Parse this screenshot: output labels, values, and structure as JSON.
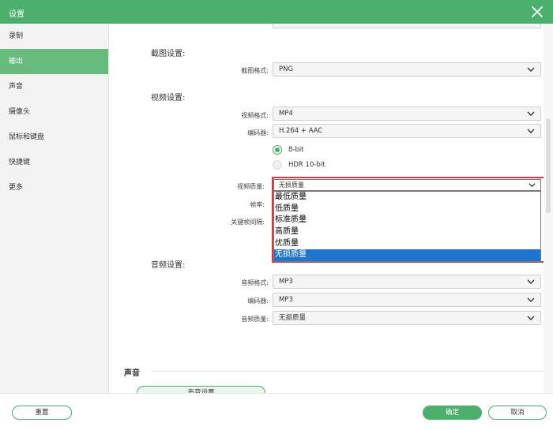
{
  "window": {
    "title": "设置"
  },
  "sidebar": {
    "items": [
      {
        "label": "录制",
        "active": false
      },
      {
        "label": "输出",
        "active": true
      },
      {
        "label": "声音",
        "active": false
      },
      {
        "label": "摄像头",
        "active": false
      },
      {
        "label": "鼠标和键盘",
        "active": false
      },
      {
        "label": "快捷键",
        "active": false
      },
      {
        "label": "更多",
        "active": false
      }
    ]
  },
  "screenshot_settings": {
    "heading": "截图设置:",
    "format_label": "截图格式:",
    "format_value": "PNG"
  },
  "video_settings": {
    "heading": "视频设置:",
    "format_label": "视频格式:",
    "format_value": "MP4",
    "encoder_label": "编码器:",
    "encoder_value": "H.264 + AAC",
    "bit_options": [
      {
        "label": "8-bit",
        "selected": true
      },
      {
        "label": "HDR 10-bit",
        "selected": false
      }
    ],
    "quality_label": "视频质量:",
    "quality_value": "无损质量",
    "quality_options": [
      "最低质量",
      "低质量",
      "标准质量",
      "高质量",
      "优质量",
      "无损质量"
    ],
    "quality_selected_index": 5,
    "framerate_label": "帧率:",
    "keyframe_label": "关键帧间隔:"
  },
  "audio_settings": {
    "heading": "音频设置:",
    "format_label": "音频格式:",
    "format_value": "MP3",
    "encoder_label": "编码器:",
    "encoder_value": "MP3",
    "quality_label": "音频质量:",
    "quality_value": "无损质量"
  },
  "sound_section": {
    "heading": "声音",
    "button_label": "声音设置"
  },
  "footer": {
    "reset_label": "重置",
    "ok_label": "确定",
    "cancel_label": "取消"
  },
  "colors": {
    "brand_green": "#4caf6b",
    "sidebar_active": "#67bb7d",
    "highlight_blue": "#1e75d0",
    "annotation_red": "#e2363a"
  }
}
